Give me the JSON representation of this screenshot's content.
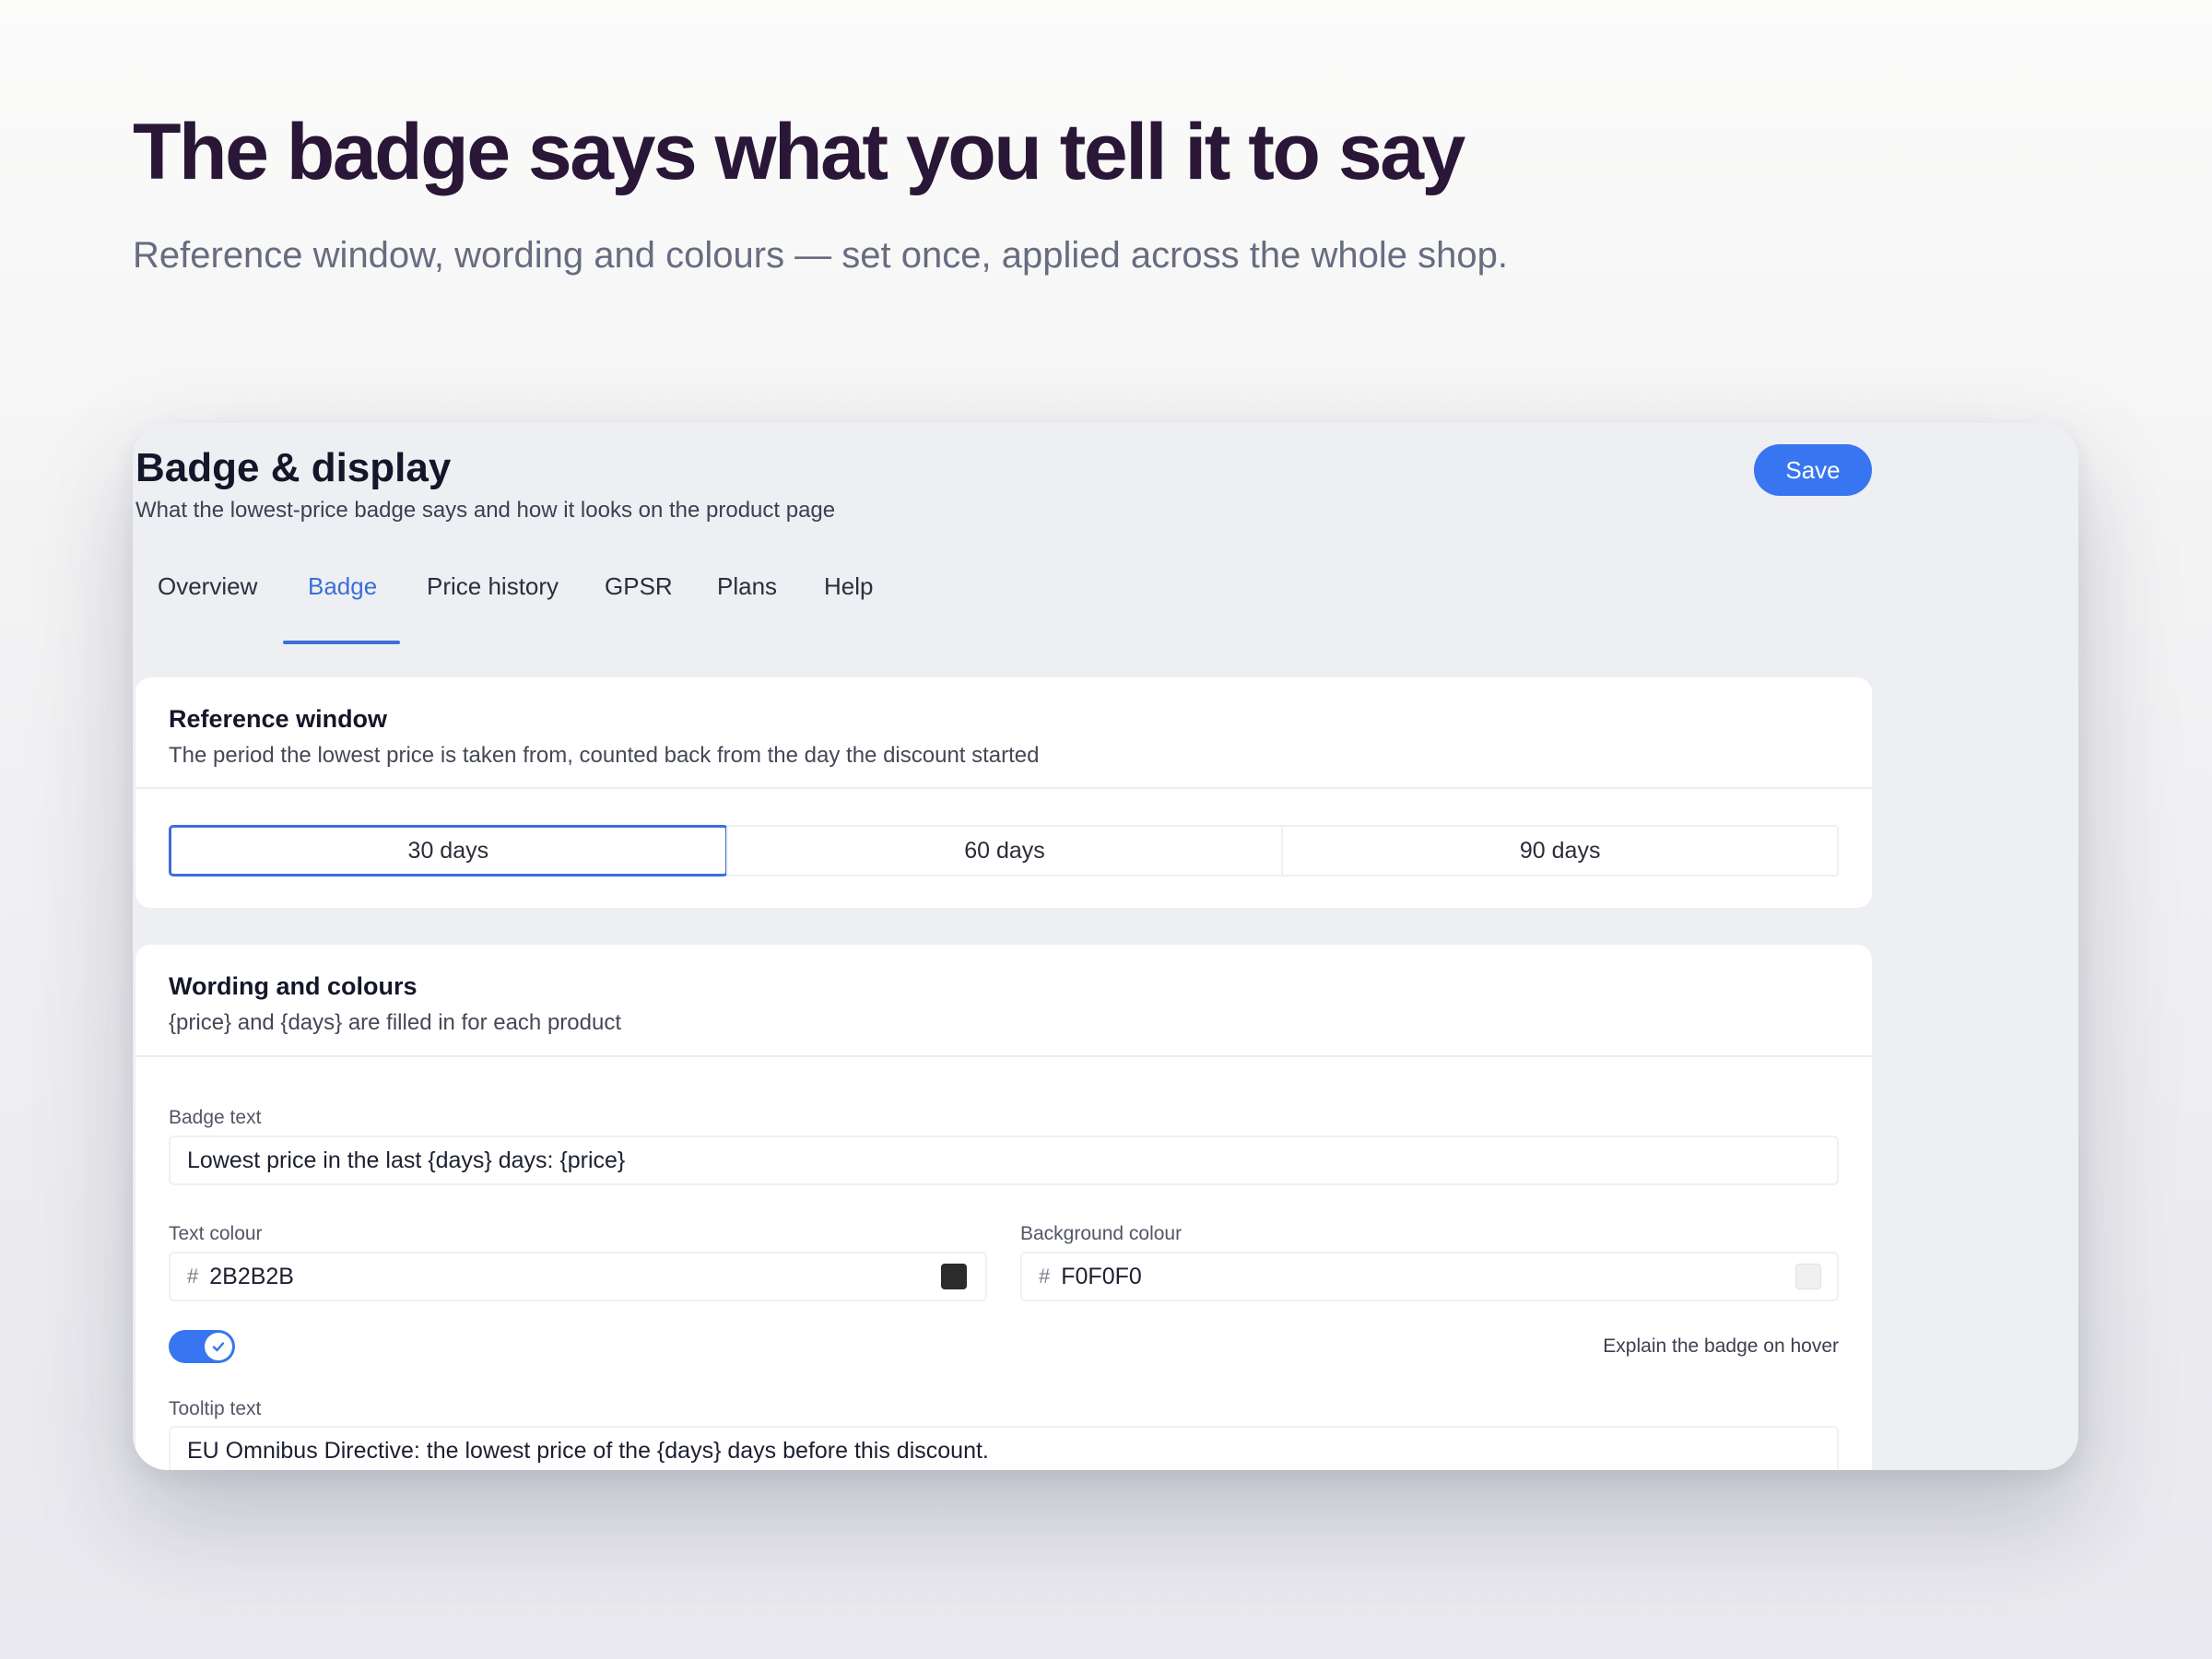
{
  "hero": {
    "title": "The badge says what you tell it to say",
    "subtitle": "Reference window, wording and colours — set once, applied across the whole shop."
  },
  "page": {
    "title": "Badge & display",
    "subtitle": "What the lowest-price badge says and how it looks on the product page",
    "save_label": "Save"
  },
  "tabs": [
    {
      "label": "Overview",
      "active": false
    },
    {
      "label": "Badge",
      "active": true
    },
    {
      "label": "Price history",
      "active": false
    },
    {
      "label": "GPSR",
      "active": false
    },
    {
      "label": "Plans",
      "active": false
    },
    {
      "label": "Help",
      "active": false
    }
  ],
  "reference_window": {
    "title": "Reference window",
    "description": "The period the lowest price is taken from, counted back from the day the discount started",
    "options": [
      "30 days",
      "60 days",
      "90 days"
    ],
    "selected": "30 days"
  },
  "wording": {
    "title": "Wording and colours",
    "description": "{price} and {days} are filled in for each product",
    "badge_text_label": "Badge text",
    "badge_text_value": "Lowest price in the last {days} days: {price}",
    "text_colour_label": "Text colour",
    "text_colour_value": "2B2B2B",
    "background_colour_label": "Background colour",
    "background_colour_value": "F0F0F0",
    "hash_symbol": "#",
    "toggle_label": "Explain the badge on hover",
    "toggle_on": true,
    "tooltip_label": "Tooltip text",
    "tooltip_value": "EU Omnibus Directive: the lowest price of the {days} days before this discount."
  },
  "colors": {
    "accent": "#3875f0",
    "text_swatch": "#2b2b2b",
    "background_swatch": "#f0f0f0"
  }
}
